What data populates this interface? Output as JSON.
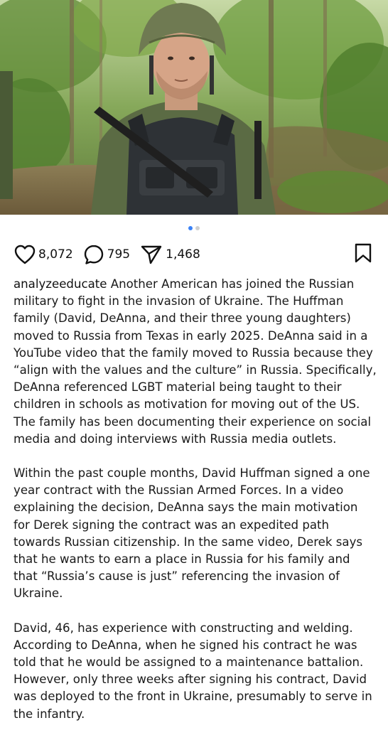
{
  "post": {
    "image_alt": "Man in helmet and tactical vest standing in a forest",
    "carousel": {
      "total": 2,
      "active": 1
    },
    "likes": "8,072",
    "comments": "795",
    "shares": "1,468"
  },
  "caption": {
    "username": "analyzeeducate",
    "paragraph1": "Another American has joined the Russian military to fight in the invasion of Ukraine. The Huffman family (David, DeAnna, and their three young daughters) moved to Russia from Texas in early 2025. DeAnna said in a YouTube video that the family moved to Russia because they “align with the values and the culture” in Russia. Specifically, DeAnna referenced LGBT material being taught to their children in schools as motivation for moving out of the US. The family has been documenting their experience on social media and doing interviews with Russia media outlets.",
    "paragraph2": "Within the past couple months, David Huffman signed a one year contract with the Russian Armed Forces. In a video explaining the decision, DeAnna says the main motivation for Derek signing the contract was an expedited path towards Russian citizenship. In the same video, Derek says that he wants to earn a place in Russia for his family and that “Russia’s cause is just” referencing the invasion of Ukraine.",
    "paragraph3": "David, 46, has experience with constructing and welding. According to DeAnna, when he signed his contract he was told that he would be assigned to a maintenance battalion. However, only three weeks after signing his contract, David was deployed to the front in Ukraine, presumably to serve in the infantry."
  },
  "icons": {
    "like": "heart-icon",
    "comment": "comment-bubble-icon",
    "share": "paper-plane-icon",
    "save": "bookmark-icon"
  },
  "colors": {
    "carousel_active": "#3b82f6",
    "carousel_inactive": "#cfcfcf"
  }
}
